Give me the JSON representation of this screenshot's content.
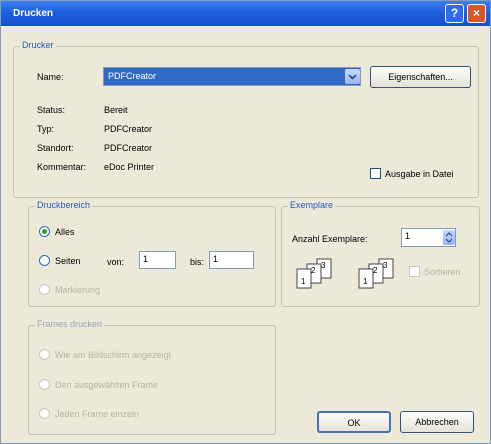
{
  "window": {
    "title": "Drucken",
    "help_glyph": "?",
    "close_glyph": "×"
  },
  "printer": {
    "legend": "Drucker",
    "name_label": "Name:",
    "name_value": "PDFCreator",
    "properties_button": "Eigenschaften...",
    "status_label": "Status:",
    "status_value": "Bereit",
    "type_label": "Typ:",
    "type_value": "PDFCreator",
    "location_label": "Standort:",
    "location_value": "PDFCreator",
    "comment_label": "Kommentar:",
    "comment_value": "eDoc Printer",
    "print_to_file_label": "Ausgabe in Datei"
  },
  "range": {
    "legend": "Druckbereich",
    "all_label": "Alles",
    "pages_label": "Seiten",
    "from_label": "von:",
    "from_value": "1",
    "to_label": "bis:",
    "to_value": "1",
    "selection_label": "Markierung"
  },
  "copies": {
    "legend": "Exemplare",
    "count_label": "Anzahl Exemplare:",
    "count_value": "1",
    "collate_label": "Sortieren"
  },
  "frames": {
    "legend": "Frames drucken",
    "options": [
      "Wie am Bildschirm angezeigt",
      "Den ausgewählten Frame",
      "Jeden Frame einzeln"
    ]
  },
  "buttons": {
    "ok": "OK",
    "cancel": "Abbrechen"
  }
}
